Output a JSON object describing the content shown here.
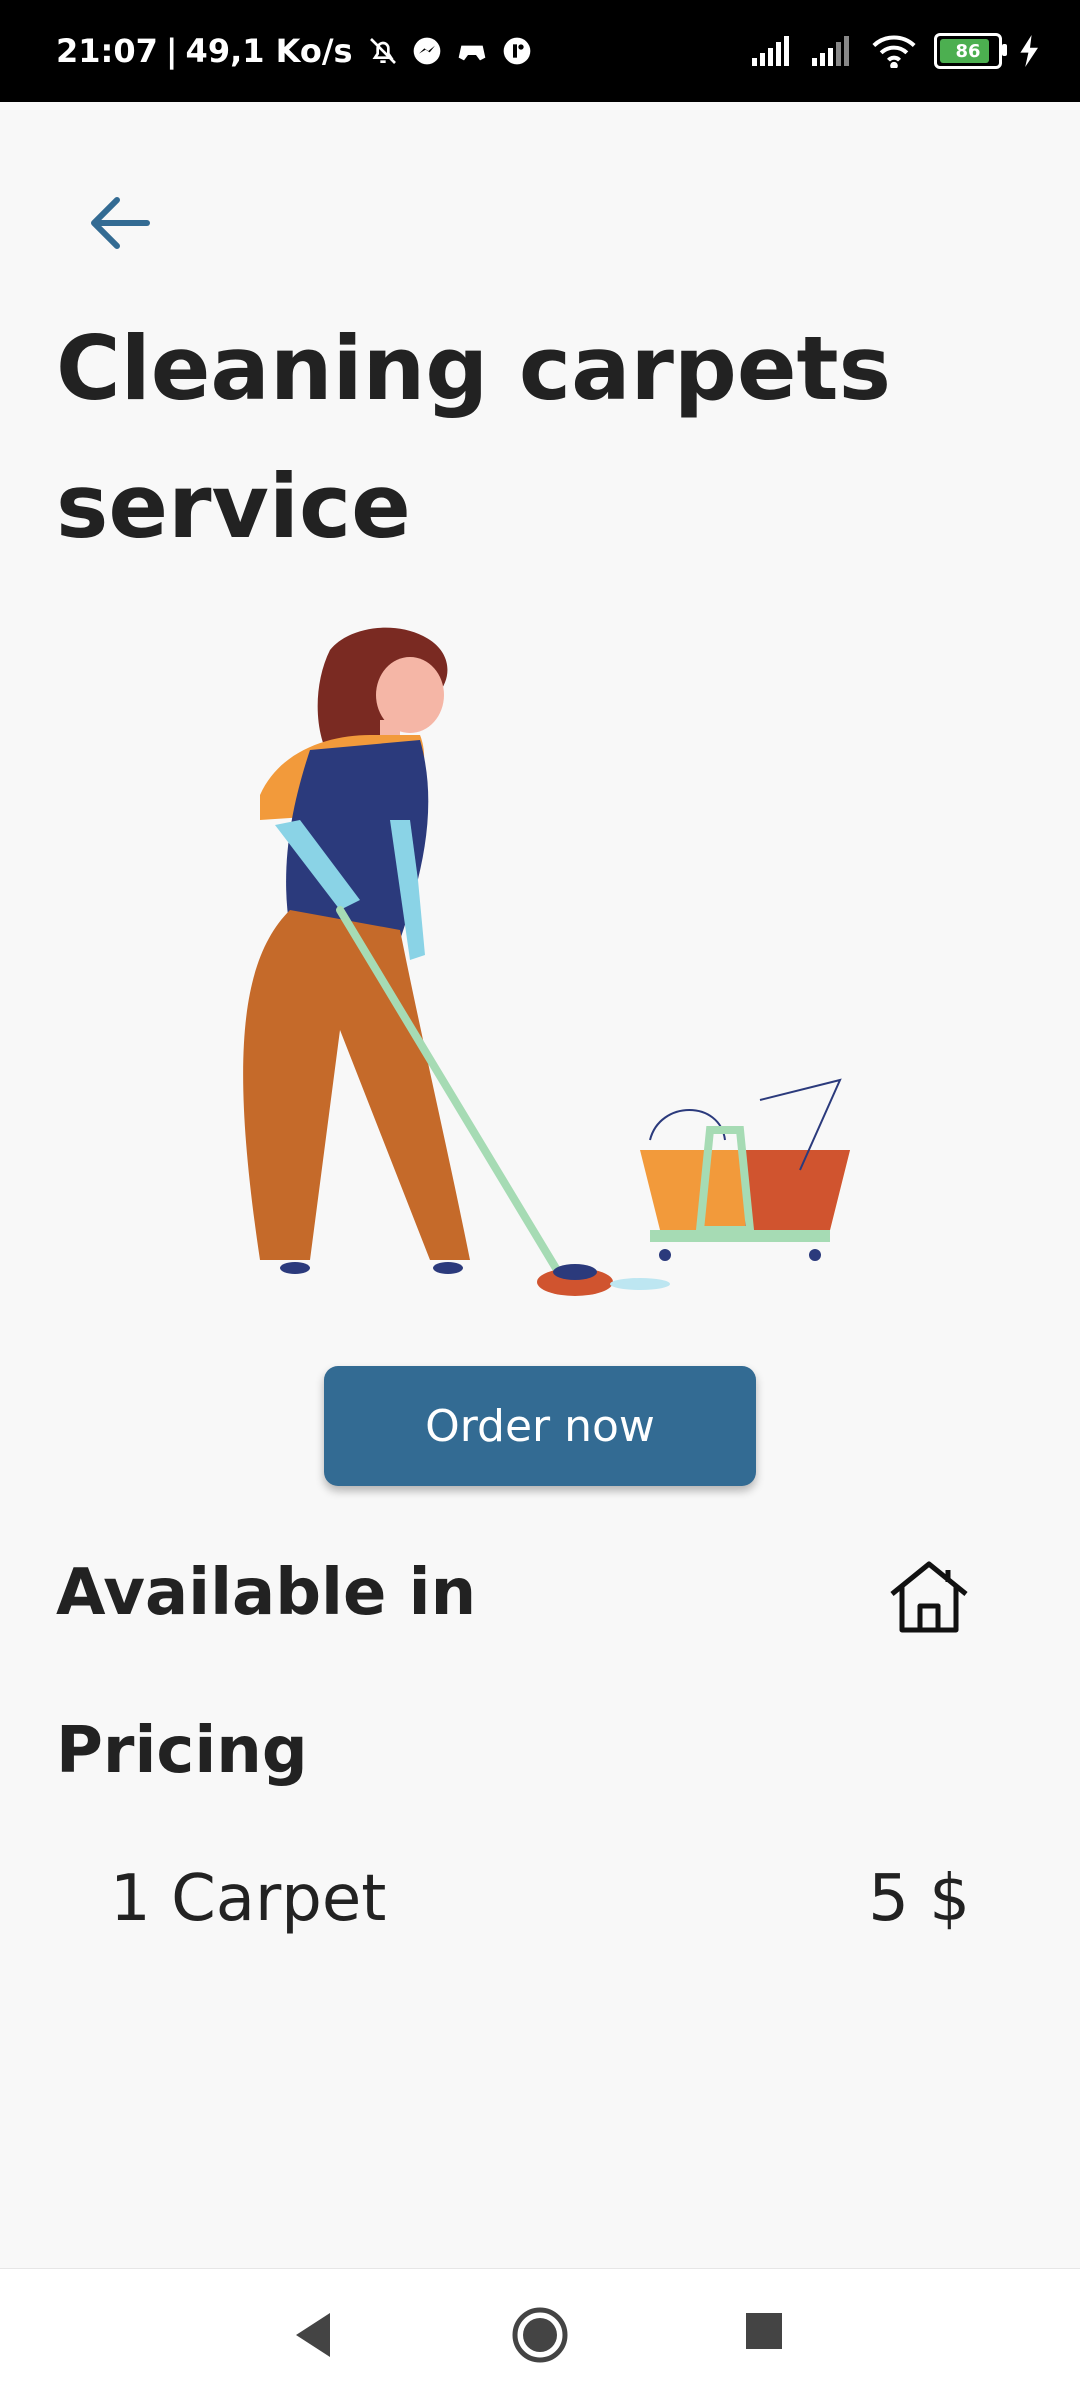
{
  "status_bar": {
    "time": "21:07",
    "separator": "|",
    "speed": "49,1 Ko/s",
    "battery_level": "86",
    "icons": [
      "bell-off-icon",
      "messenger-icon",
      "game-icon",
      "app-icon",
      "signal-icon",
      "signal-icon",
      "wifi-icon",
      "battery-icon",
      "charging-icon"
    ]
  },
  "header": {
    "back_icon": "arrow-left-icon",
    "title": "Cleaning carpets service"
  },
  "illustration": {
    "name": "woman-cleaning-carpet-illustration"
  },
  "actions": {
    "order_label": "Order now"
  },
  "details": {
    "available_label": "Available in",
    "available_icon": "house-icon",
    "pricing_label": "Pricing",
    "pricing_rows": [
      {
        "item": "1 Carpet",
        "price": "5 $"
      }
    ]
  },
  "navigation_bar": {
    "icons": [
      "nav-back-icon",
      "nav-home-icon",
      "nav-recent-icon"
    ]
  },
  "colors": {
    "primary": "#336b93",
    "background": "#f8f8f8",
    "text": "#222222"
  }
}
